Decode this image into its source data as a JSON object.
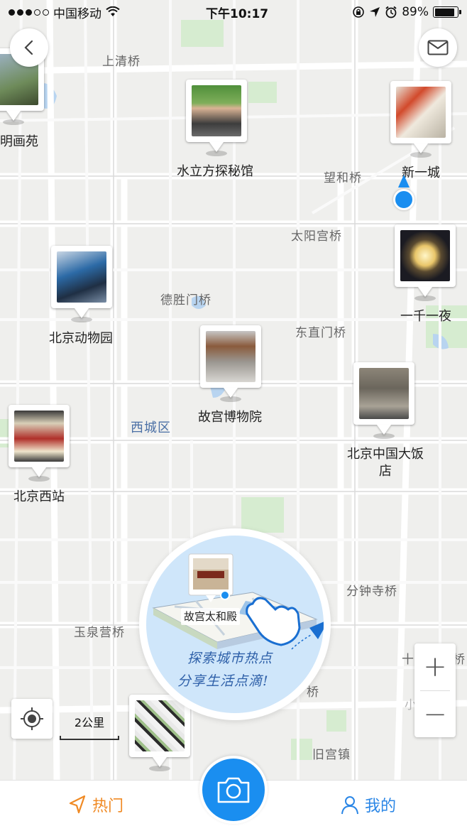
{
  "status_bar": {
    "carrier": "中国移动",
    "time": "下午10:17",
    "battery_text": "89%",
    "battery_level": 0.89
  },
  "map": {
    "place_labels": [
      "上清桥",
      "望和桥",
      "太阳宫桥",
      "德胜门桥",
      "东直门桥",
      "分钟寺桥",
      "玉泉营桥",
      "十八里店桥",
      "桥",
      "小红门",
      "旧宫镇"
    ],
    "district_label": "西城区",
    "pins": [
      {
        "name": "明画苑"
      },
      {
        "name": "水立方探秘馆"
      },
      {
        "name": "新一城"
      },
      {
        "name": "一千一夜"
      },
      {
        "name": "北京动物园"
      },
      {
        "name": "故宫博物院"
      },
      {
        "name": "北京中国大饭店"
      },
      {
        "name": "北京西站"
      }
    ]
  },
  "explore": {
    "pin_label": "故宫太和殿",
    "slogan_line1": "探索城市热点",
    "slogan_line2": "分享生活点滴!"
  },
  "scale": {
    "label": "2公里"
  },
  "zoom": {
    "in": "+",
    "out": "−"
  },
  "tabs": {
    "hot": "热门",
    "mine": "我的"
  },
  "icons": {
    "back": "chevron-left-icon",
    "mail": "envelope-icon",
    "locate": "crosshair-icon",
    "camera": "camera-icon",
    "hot": "navigation-arrow-icon",
    "mine": "person-icon"
  },
  "colors": {
    "accent_blue": "#1a8ef0",
    "hot_orange": "#f08a24",
    "mine_blue": "#2a86e6",
    "district_blue": "#4a6fa5"
  }
}
